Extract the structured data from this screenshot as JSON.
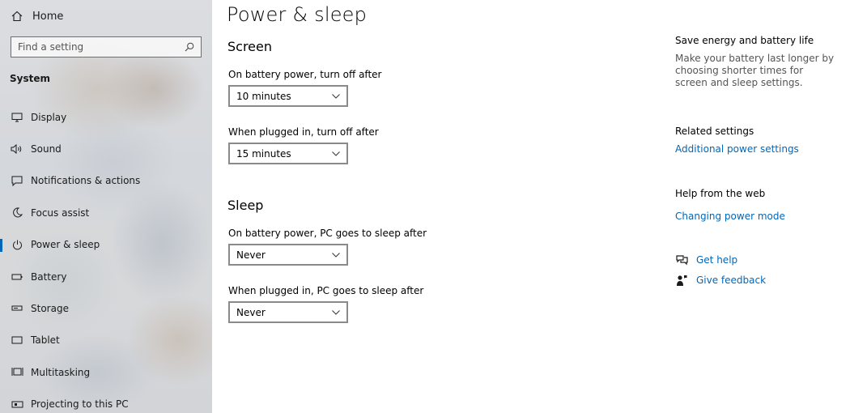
{
  "sidebar": {
    "home_label": "Home",
    "search_placeholder": "Find a setting",
    "section_label": "System",
    "items": [
      {
        "label": "Display",
        "icon": "monitor-icon"
      },
      {
        "label": "Sound",
        "icon": "speaker-icon"
      },
      {
        "label": "Notifications & actions",
        "icon": "notification-icon"
      },
      {
        "label": "Focus assist",
        "icon": "moon-icon"
      },
      {
        "label": "Power & sleep",
        "icon": "power-icon",
        "active": true
      },
      {
        "label": "Battery",
        "icon": "battery-icon"
      },
      {
        "label": "Storage",
        "icon": "storage-icon"
      },
      {
        "label": "Tablet",
        "icon": "tablet-icon"
      },
      {
        "label": "Multitasking",
        "icon": "multitasking-icon"
      },
      {
        "label": "Projecting to this PC",
        "icon": "projector-icon"
      }
    ]
  },
  "main": {
    "title": "Power & sleep",
    "screen": {
      "heading": "Screen",
      "battery_label": "On battery power, turn off after",
      "battery_value": "10 minutes",
      "plugged_label": "When plugged in, turn off after",
      "plugged_value": "15 minutes"
    },
    "sleep": {
      "heading": "Sleep",
      "battery_label": "On battery power, PC goes to sleep after",
      "battery_value": "Never",
      "plugged_label": "When plugged in, PC goes to sleep after",
      "plugged_value": "Never"
    }
  },
  "right": {
    "save_heading": "Save energy and battery life",
    "save_text": "Make your battery last longer by choosing shorter times for screen and sleep settings.",
    "related_heading": "Related settings",
    "related_link": "Additional power settings",
    "help_heading": "Help from the web",
    "help_link": "Changing power mode",
    "get_help": "Get help",
    "give_feedback": "Give feedback"
  },
  "colors": {
    "accent": "#0067b8",
    "sidebar_bg": "#d6d8dc",
    "dropdown_border": "#8a8a8a",
    "muted_text": "#555555"
  }
}
